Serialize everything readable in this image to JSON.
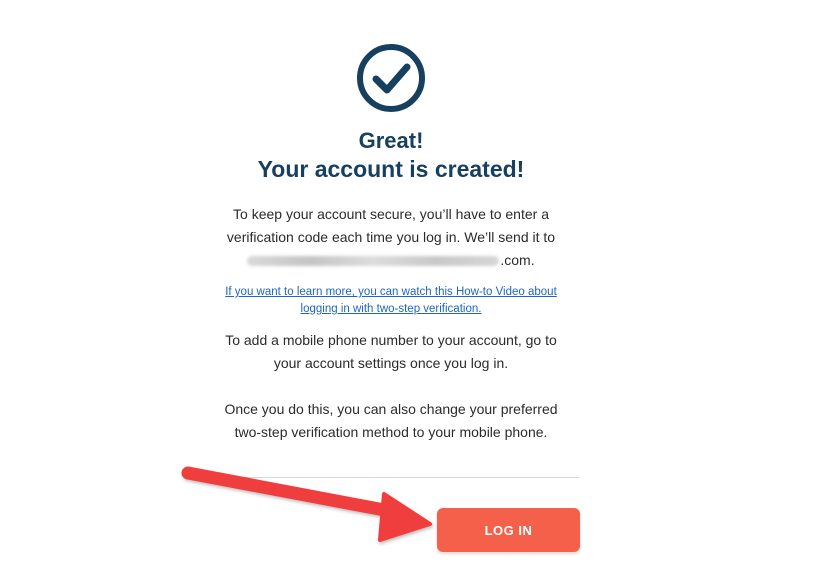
{
  "icons": {
    "success": "check-circle-icon",
    "annotation": "red-arrow-icon"
  },
  "colors": {
    "heading": "#173f5f",
    "link": "#1f66c1",
    "button": "#f5604a",
    "arrow": "#f03e3e"
  },
  "heading": {
    "line1": "Great!",
    "line2": "Your account is created!"
  },
  "secure_message": {
    "line1": "To keep your account secure, you’ll have to enter a",
    "line2": "verification code each time you log in. We’ll send it to",
    "email_suffix": ".com."
  },
  "help_link": {
    "line1": "If you want to learn more, you can watch this How-to Video about",
    "line2": "logging in with two-step verification."
  },
  "mobile_message": {
    "line1": "To add a mobile phone number to your account, go to",
    "line2": "your account settings once you log in."
  },
  "method_message": {
    "line1": "Once you do this, you can also change your preferred",
    "line2": "two-step verification method to your mobile phone."
  },
  "login_button": {
    "label": "LOG IN"
  }
}
